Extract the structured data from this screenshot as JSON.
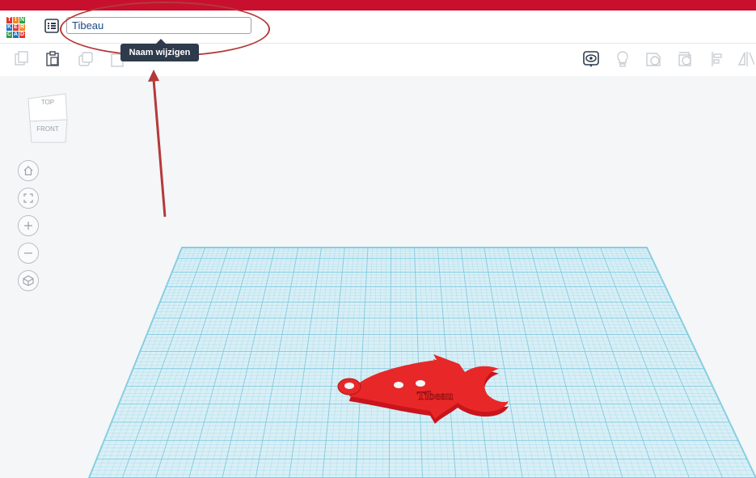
{
  "header": {
    "logo_letters": [
      "T",
      "I",
      "N",
      "K",
      "E",
      "R",
      "C",
      "A",
      "D"
    ],
    "logo_colors": [
      "#e2352b",
      "#f08a24",
      "#2ea04a",
      "#1e74c4",
      "#e2352b",
      "#f08a24",
      "#2ea04a",
      "#1e74c4",
      "#e2352b"
    ],
    "design_name": "Tibeau",
    "tooltip": "Naam wijzigen"
  },
  "toolbar": {
    "left_icons": [
      "copy-icon",
      "paste-icon",
      "duplicate-icon",
      "delete-icon"
    ],
    "right_icons": [
      "show-all-icon",
      "note-icon",
      "group-icon",
      "ungroup-icon",
      "align-icon",
      "mirror-icon"
    ]
  },
  "viewport": {
    "viewcube": {
      "top_label": "TOP",
      "front_label": "FRONT"
    },
    "nav_buttons": [
      "home-view-icon",
      "fit-view-icon",
      "zoom-in-icon",
      "zoom-out-icon",
      "perspective-icon"
    ],
    "model_text": "Tibeau"
  },
  "annotation": {
    "color": "#b5393a"
  },
  "colors": {
    "brand_red": "#c8102e",
    "grid_line": "#78c7de",
    "grid_fill": "#d9eff6",
    "model_red": "#e02020"
  }
}
